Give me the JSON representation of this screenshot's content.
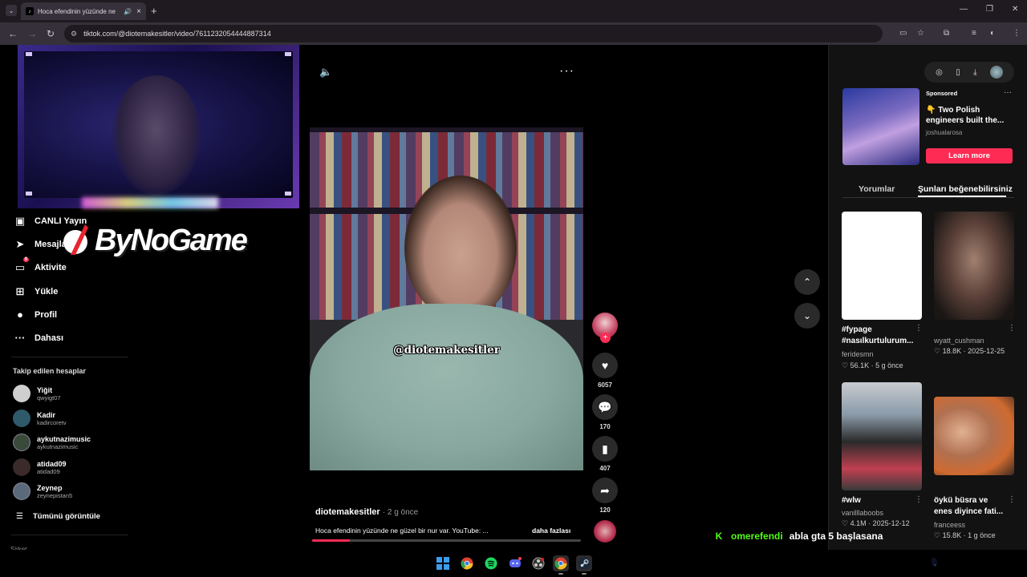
{
  "browser": {
    "tab_title": "Hoca efendinin yüzünde ne",
    "url": "tiktok.com/@diotemakesitler/video/7611232054444887314"
  },
  "sidebar": {
    "items": [
      {
        "label": "CANLI Yayın",
        "icon": "live-icon"
      },
      {
        "label": "Mesajlar",
        "icon": "messages-icon"
      },
      {
        "label": "Aktivite",
        "icon": "activity-icon",
        "badge": "9"
      },
      {
        "label": "Yükle",
        "icon": "upload-icon"
      },
      {
        "label": "Profil",
        "icon": "profile-icon"
      },
      {
        "label": "Dahası",
        "icon": "more-icon"
      }
    ],
    "following_heading": "Takip edilen hesaplar",
    "following": [
      {
        "name": "Yiğit",
        "handle": "qwyigt07",
        "color": "#cfcfcf"
      },
      {
        "name": "Kadir",
        "handle": "kadircoretv",
        "color": "#2f5a6a"
      },
      {
        "name": "aykutnazimusic",
        "handle": "aykutnazimusic",
        "color": "#3a4a3a"
      },
      {
        "name": "atidad09",
        "handle": "atidad09",
        "color": "#3a2a2a"
      },
      {
        "name": "Zeynep",
        "handle": "zeynepistan5",
        "color": "#5a6a7a"
      }
    ],
    "see_all": "Tümünü görüntüle",
    "footer": "Şirket"
  },
  "overlay": {
    "logo_text": "ByNoGame"
  },
  "video": {
    "watermark": "@diotemakesitler",
    "author": "diotemakesitler",
    "posted": "· 2 g önce",
    "caption": "Hoca efendinin yüzünde ne güzel bir nur var. YouTube: ...",
    "more_label": "daha fazlası",
    "progress": 0.14,
    "likes": "6057",
    "comments": "170",
    "saves": "407",
    "shares": "120"
  },
  "ad": {
    "sponsored": "Sponsored",
    "title": "👇 Two Polish engineers built the...",
    "handle": "joshualarosa",
    "cta": "Learn more"
  },
  "right_tabs": {
    "comments": "Yorumlar",
    "suggested": "Şunları beğenebilirsiniz"
  },
  "suggestions": [
    {
      "title": "#fypage #nasılkurtulurum...",
      "user": "feridesmn",
      "likes": "♡ 56.1K",
      "date": "· 5 g önce"
    },
    {
      "title": "",
      "user": "wyatt_cushman",
      "likes": "♡ 18.8K",
      "date": "· 2025-12-25"
    },
    {
      "title": "#wlw",
      "user": "vanilllaboobs",
      "likes": "♡ 4.1M",
      "date": "· 2025-12-12"
    },
    {
      "title": "öykü büsra ve enes diyince fati...",
      "user": "franceess",
      "likes": "♡ 15.8K",
      "date": "· 1 g önce"
    }
  ],
  "chat": {
    "user": "omerefendi",
    "message": "abla gta 5 başlasana"
  },
  "colors": {
    "accent": "#fe2c55",
    "kick_green": "#53fc18"
  }
}
